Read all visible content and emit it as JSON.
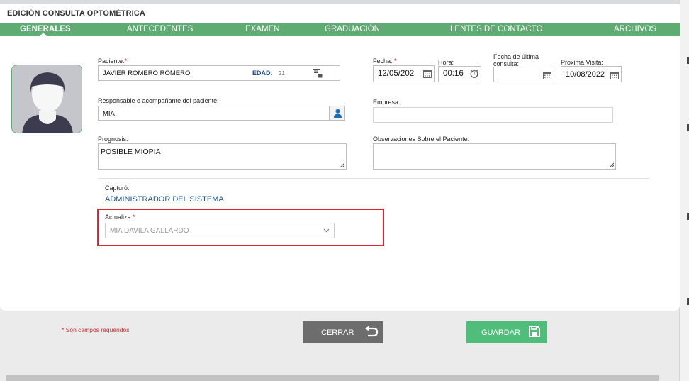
{
  "header": {
    "title": "EDICIÓN CONSULTA OPTOMÉTRICA"
  },
  "tabs": [
    {
      "label": "GENERALES",
      "active": true
    },
    {
      "label": "ANTECEDENTES"
    },
    {
      "label": "EXAMEN"
    },
    {
      "label": "GRADUACIÓN"
    },
    {
      "label": "LENTES DE CONTACTO"
    },
    {
      "label": "ARCHIVOS"
    }
  ],
  "form": {
    "paciente": {
      "label": "Paciente:",
      "required": "*",
      "value": "JAVIER ROMERO ROMERO",
      "edad_label": "EDAD:",
      "edad_value": "21"
    },
    "fecha": {
      "label": "Fecha:",
      "required": "*",
      "value": "12/05/202"
    },
    "hora": {
      "label": "Hora:",
      "value": "00:16"
    },
    "ultima_consulta": {
      "label_line1": "Fecha de última",
      "label_line2": "consulta:",
      "value": ""
    },
    "proxima_visita": {
      "label": "Proxima Visita:",
      "value": "10/08/2022"
    },
    "responsable": {
      "label": "Responsable o acompañante del paciente:",
      "value": "MIA"
    },
    "empresa": {
      "label": "Empresa",
      "value": ""
    },
    "prognosis": {
      "label": "Prognosis:",
      "value": "POSIBLE MIOPIA"
    },
    "observaciones": {
      "label": "Observaciones Sobre el Paciente:",
      "value": ""
    },
    "capturo": {
      "label": "Capturó:",
      "value": "ADMINISTRADOR DEL SISTEMA"
    },
    "actualiza": {
      "label": "Actualiza:",
      "required": "*",
      "value": "MIA DAVILA GALLARDO"
    }
  },
  "footer": {
    "required_note": "* Son campos requeridos",
    "cerrar_label": "CERRAR",
    "guardar_label": "GUARDAR"
  },
  "colors": {
    "accent": "#5fac72",
    "save": "#50bd7b",
    "close": "#6d6d6d",
    "highlight": "#e0252c",
    "required": "#d32f2f",
    "capturo": "#1e4e8c"
  },
  "icons": [
    "user-avatar-icon",
    "id-card-icon",
    "calendar-icon",
    "clock-icon",
    "person-icon",
    "chevron-down-icon",
    "undo-icon",
    "floppy-disk-icon",
    "resize-grip-icon"
  ]
}
